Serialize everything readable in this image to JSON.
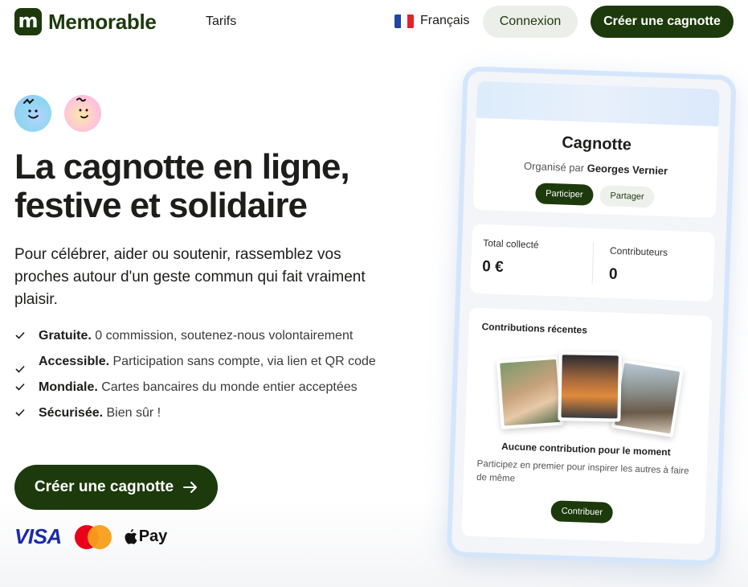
{
  "nav": {
    "logo_letter": "m",
    "logo_text": "Memorable",
    "tarifs": "Tarifs",
    "language": "Français",
    "login": "Connexion",
    "create": "Créer une cagnotte"
  },
  "hero": {
    "title_line1": "La cagnotte en ligne,",
    "title_line2": "festive et solidaire",
    "subtitle": "Pour célébrer, aider ou soutenir, rassemblez vos proches autour d'un geste commun qui fait vraiment plaisir.",
    "features": [
      {
        "bold": "Gratuite.",
        "text": " 0 commission, soutenez-nous volontairement"
      },
      {
        "bold": "Accessible.",
        "text": " Participation sans compte, via lien et QR code"
      },
      {
        "bold": "Mondiale.",
        "text": " Cartes bancaires du monde entier acceptées"
      },
      {
        "bold": "Sécurisée.",
        "text": " Bien sûr !"
      }
    ],
    "cta": "Créer une cagnotte",
    "payments": {
      "visa": "VISA",
      "apple_pay": "Pay"
    }
  },
  "preview": {
    "title": "Cagnotte",
    "organizer_prefix": "Organisé par",
    "organizer_name": "Georges Vernier",
    "participate": "Participer",
    "share": "Partager",
    "total_label": "Total collecté",
    "total_value": "0 €",
    "contributors_label": "Contributeurs",
    "contributors_value": "0",
    "recent_title": "Contributions récentes",
    "empty_title": "Aucune contribution pour le moment",
    "empty_desc": "Participez en premier pour inspirer les autres à faire de même",
    "contribute": "Contribuer"
  },
  "colors": {
    "brand": "#1c3a0c",
    "light_button": "#eceee9",
    "phone_border": "#d4e6fb"
  }
}
